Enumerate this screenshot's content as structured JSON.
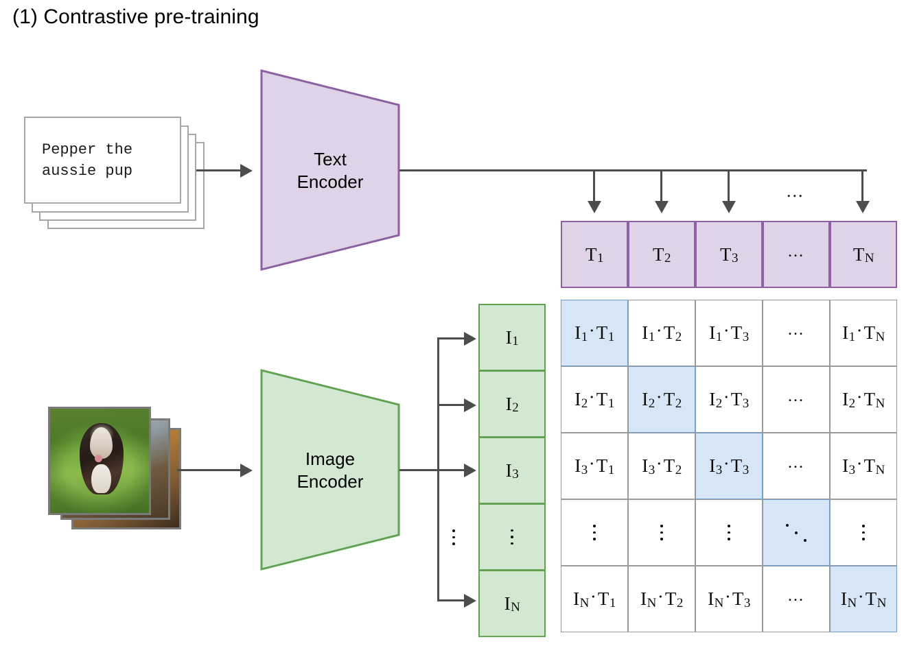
{
  "title": "(1) Contrastive pre-training",
  "caption_card": {
    "line1": "Pepper the",
    "line2": "aussie pup",
    "stack_count": 4
  },
  "image_stack": {
    "stack_count": 3,
    "alt": "puppy on grass photo stack"
  },
  "encoders": {
    "text": {
      "line1": "Text",
      "line2": "Encoder",
      "fill": "#e0d3e8",
      "stroke": "#8f5fa3"
    },
    "image": {
      "line1": "Image",
      "line2": "Encoder",
      "fill": "#d3e8d0",
      "stroke": "#62a353"
    }
  },
  "text_embeddings": {
    "fill": "#e0d3e8",
    "stroke": "#8f5fa3",
    "cells": [
      {
        "base": "T",
        "sub": "1"
      },
      {
        "base": "T",
        "sub": "2"
      },
      {
        "base": "T",
        "sub": "3"
      },
      {
        "base": "...",
        "sub": ""
      },
      {
        "base": "T",
        "sub": "N"
      }
    ],
    "branch_ellipsis": "..."
  },
  "image_embeddings": {
    "fill": "#d3e8d0",
    "stroke": "#62a353",
    "cells": [
      {
        "base": "I",
        "sub": "1"
      },
      {
        "base": "I",
        "sub": "2"
      },
      {
        "base": "I",
        "sub": "3"
      },
      {
        "base": "vdots",
        "sub": ""
      },
      {
        "base": "I",
        "sub": "N"
      }
    ],
    "branch_ellipsis": "vdots"
  },
  "similarity_matrix": {
    "diagonal_fill": "#d7e6f7",
    "diagonal_stroke": "#6f9dd0",
    "cell_fill": "#ffffff",
    "cell_stroke": "#9a9a9a",
    "row_labels": [
      "I1",
      "I2",
      "I3",
      "...",
      "IN"
    ],
    "col_labels": [
      "T1",
      "T2",
      "T3",
      "...",
      "TN"
    ],
    "rows": [
      [
        {
          "i": "I",
          "isub": "1",
          "t": "T",
          "tsub": "1",
          "kind": "dot",
          "diag": true
        },
        {
          "i": "I",
          "isub": "1",
          "t": "T",
          "tsub": "2",
          "kind": "dot",
          "diag": false
        },
        {
          "i": "I",
          "isub": "1",
          "t": "T",
          "tsub": "3",
          "kind": "dot",
          "diag": false
        },
        {
          "i": "",
          "isub": "",
          "t": "",
          "tsub": "",
          "kind": "hdots",
          "diag": false
        },
        {
          "i": "I",
          "isub": "1",
          "t": "T",
          "tsub": "N",
          "kind": "dot",
          "diag": false
        }
      ],
      [
        {
          "i": "I",
          "isub": "2",
          "t": "T",
          "tsub": "1",
          "kind": "dot",
          "diag": false
        },
        {
          "i": "I",
          "isub": "2",
          "t": "T",
          "tsub": "2",
          "kind": "dot",
          "diag": true
        },
        {
          "i": "I",
          "isub": "2",
          "t": "T",
          "tsub": "3",
          "kind": "dot",
          "diag": false
        },
        {
          "i": "",
          "isub": "",
          "t": "",
          "tsub": "",
          "kind": "hdots",
          "diag": false
        },
        {
          "i": "I",
          "isub": "2",
          "t": "T",
          "tsub": "N",
          "kind": "dot",
          "diag": false
        }
      ],
      [
        {
          "i": "I",
          "isub": "3",
          "t": "T",
          "tsub": "1",
          "kind": "dot",
          "diag": false
        },
        {
          "i": "I",
          "isub": "3",
          "t": "T",
          "tsub": "2",
          "kind": "dot",
          "diag": false
        },
        {
          "i": "I",
          "isub": "3",
          "t": "T",
          "tsub": "3",
          "kind": "dot",
          "diag": true
        },
        {
          "i": "",
          "isub": "",
          "t": "",
          "tsub": "",
          "kind": "hdots",
          "diag": false
        },
        {
          "i": "I",
          "isub": "3",
          "t": "T",
          "tsub": "N",
          "kind": "dot",
          "diag": false
        }
      ],
      [
        {
          "i": "",
          "isub": "",
          "t": "",
          "tsub": "",
          "kind": "vdots",
          "diag": false
        },
        {
          "i": "",
          "isub": "",
          "t": "",
          "tsub": "",
          "kind": "vdots",
          "diag": false
        },
        {
          "i": "",
          "isub": "",
          "t": "",
          "tsub": "",
          "kind": "vdots",
          "diag": false
        },
        {
          "i": "",
          "isub": "",
          "t": "",
          "tsub": "",
          "kind": "ddots",
          "diag": true
        },
        {
          "i": "",
          "isub": "",
          "t": "",
          "tsub": "",
          "kind": "vdots",
          "diag": false
        }
      ],
      [
        {
          "i": "I",
          "isub": "N",
          "t": "T",
          "tsub": "1",
          "kind": "dot",
          "diag": false
        },
        {
          "i": "I",
          "isub": "N",
          "t": "T",
          "tsub": "2",
          "kind": "dot",
          "diag": false
        },
        {
          "i": "I",
          "isub": "N",
          "t": "T",
          "tsub": "3",
          "kind": "dot",
          "diag": false
        },
        {
          "i": "",
          "isub": "",
          "t": "",
          "tsub": "",
          "kind": "hdots",
          "diag": false
        },
        {
          "i": "I",
          "isub": "N",
          "t": "T",
          "tsub": "N",
          "kind": "dot",
          "diag": true
        }
      ]
    ]
  },
  "connector_color": "#4d4d4d"
}
